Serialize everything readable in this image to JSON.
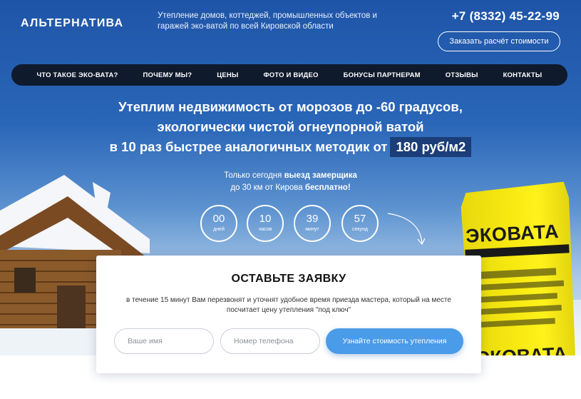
{
  "header": {
    "logo": "АЛЬТЕРНАТИВА",
    "tagline": "Утепление домов, коттеджей, промышленных объектов и гаражей эко-ватой по всей Кировской области",
    "phone": "+7 (8332) 45-22-99",
    "order_button": "Заказать расчёт стоимости"
  },
  "nav": {
    "items": [
      {
        "label": "ЧТО ТАКОЕ ЭКО-ВАТА?"
      },
      {
        "label": "ПОЧЕМУ МЫ?"
      },
      {
        "label": "ЦЕНЫ"
      },
      {
        "label": "ФОТО И ВИДЕО"
      },
      {
        "label": "БОНУСЫ ПАРТНЕРАМ"
      },
      {
        "label": "ОТЗЫВЫ"
      },
      {
        "label": "КОНТАКТЫ"
      }
    ]
  },
  "hero": {
    "line1": "Утеплим недвижимость от морозов до -60 градусов,",
    "line2": "экологически чистой огнеупорной ватой",
    "line3": "в 10 раз быстрее аналогичных методик от",
    "price": "180 руб/м2",
    "today_prefix": "Только сегодня ",
    "today_bold": "выезд замерщика",
    "today_line2": "до 30 км от Кирова ",
    "today_bold2": "бесплатно!"
  },
  "timer": [
    {
      "value": "00",
      "unit": "дней"
    },
    {
      "value": "10",
      "unit": "часов"
    },
    {
      "value": "39",
      "unit": "минут"
    },
    {
      "value": "57",
      "unit": "секунд"
    }
  ],
  "bag": {
    "brand": "ЭКОВАТА",
    "brand_bottom": "ЭКОВАТА"
  },
  "form": {
    "title": "ОСТАВЬТЕ ЗАЯВКУ",
    "text": "в течение 15 минут Вам перезвонят и уточнят удобное время приезда мастера, который на месте посчитает цену утепления \"под ключ\"",
    "name_placeholder": "Ваше имя",
    "phone_placeholder": "Номер телефона",
    "submit": "Узнайте стоимость утепления"
  },
  "colors": {
    "sky_top": "#1f55a8",
    "nav_bg": "#0f1a2c",
    "price_bg": "#1b3e78",
    "button_blue": "#4a9be8",
    "bag_yellow": "#f5e70f"
  }
}
